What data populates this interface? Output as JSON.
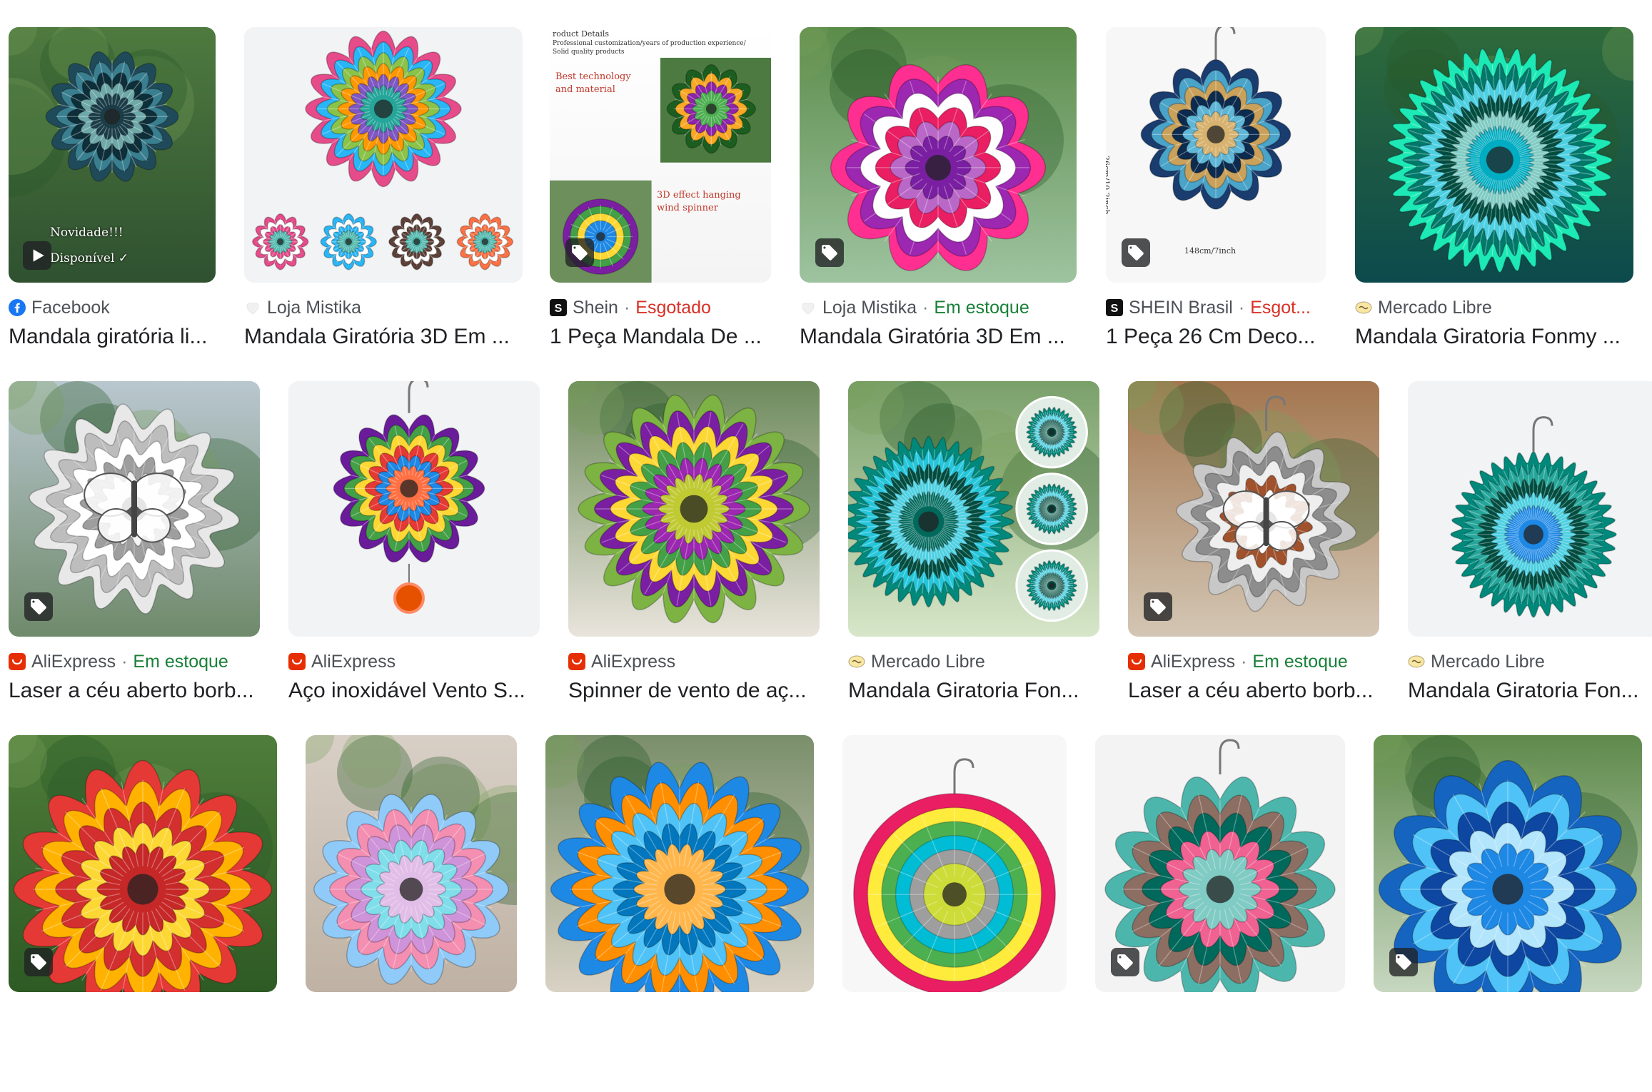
{
  "results": [
    {
      "source": "Facebook",
      "favicon": "facebook-icon",
      "title": "Mandala giratória li...",
      "badge": "play-icon",
      "overlay": [
        "Novidade!!!",
        "Disponível ✓"
      ]
    },
    {
      "source": "Loja Mistika",
      "favicon": "heart-icon",
      "title": "Mandala Giratória 3D Em ...",
      "badge": ""
    },
    {
      "source": "Shein",
      "favicon": "shein-icon",
      "status": "Esgotado",
      "status_type": "out",
      "title": "1 Peça Mandala De ...",
      "badge": "tag-icon",
      "overlay": [
        "roduct Details",
        "Professional customization/years of production experience/",
        "Solid quality products",
        "Best technology",
        "and material",
        "3D effect hanging",
        "wind spinner"
      ]
    },
    {
      "source": "Loja Mistika",
      "favicon": "heart-icon",
      "status": "Em estoque",
      "status_type": "in",
      "title": "Mandala Giratória 3D Em ...",
      "badge": "tag-icon"
    },
    {
      "source": "SHEIN Brasil",
      "favicon": "shein-icon",
      "status": "Esgot...",
      "status_type": "out",
      "title": "1 Peça 26 Cm Deco...",
      "badge": "tag-icon",
      "overlay": [
        "26cm/10.2inch",
        "148cm/7inch"
      ]
    },
    {
      "source": "Mercado Libre",
      "favicon": "mercadolibre-icon",
      "title": "Mandala Giratoria Fonmy ...",
      "badge": ""
    },
    {
      "source": "AliExpress",
      "favicon": "aliexpress-icon",
      "status": "Em estoque",
      "status_type": "in",
      "title": "Laser a céu aberto borb...",
      "badge": "tag-icon"
    },
    {
      "source": "AliExpress",
      "favicon": "aliexpress-icon",
      "title": "Aço inoxidável Vento S...",
      "badge": ""
    },
    {
      "source": "AliExpress",
      "favicon": "aliexpress-icon",
      "title": "Spinner de vento de aç...",
      "badge": ""
    },
    {
      "source": "Mercado Libre",
      "favicon": "mercadolibre-icon",
      "title": "Mandala Giratoria Fon...",
      "badge": ""
    },
    {
      "source": "AliExpress",
      "favicon": "aliexpress-icon",
      "status": "Em estoque",
      "status_type": "in",
      "title": "Laser a céu aberto borb...",
      "badge": "tag-icon"
    },
    {
      "source": "Mercado Libre",
      "favicon": "mercadolibre-icon",
      "title": "Mandala Giratoria Fon...",
      "badge": ""
    },
    {
      "source": "",
      "favicon": "",
      "title": "",
      "badge": "tag-icon"
    },
    {
      "source": "",
      "favicon": "",
      "title": "",
      "badge": ""
    },
    {
      "source": "",
      "favicon": "",
      "title": "",
      "badge": ""
    },
    {
      "source": "",
      "favicon": "",
      "title": "",
      "badge": ""
    },
    {
      "source": "",
      "favicon": "",
      "title": "",
      "badge": "tag-icon"
    },
    {
      "source": "",
      "favicon": "",
      "title": "",
      "badge": "tag-icon"
    }
  ],
  "colors": {
    "status_in": "#188038",
    "status_out": "#d93025",
    "text": "#202124",
    "source_text": "#4d5156"
  }
}
